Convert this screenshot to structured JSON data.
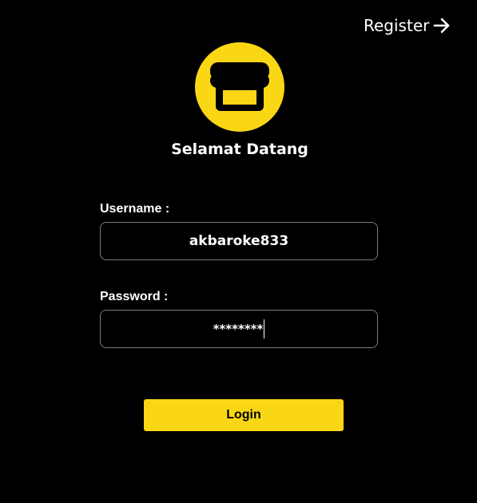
{
  "header": {
    "register_label": "Register",
    "register_icon": "arrow-right-icon"
  },
  "logo": {
    "icon": "store-icon",
    "accent_color": "#fad714"
  },
  "welcome_text": "Selamat Datang",
  "form": {
    "username_label": "Username :",
    "username_value": "akbaroke833",
    "password_label": "Password :",
    "password_value": "********",
    "login_label": "Login"
  },
  "colors": {
    "background": "#000000",
    "accent": "#fad714",
    "text": "#ffffff",
    "field_border": "#7a7a7a"
  }
}
